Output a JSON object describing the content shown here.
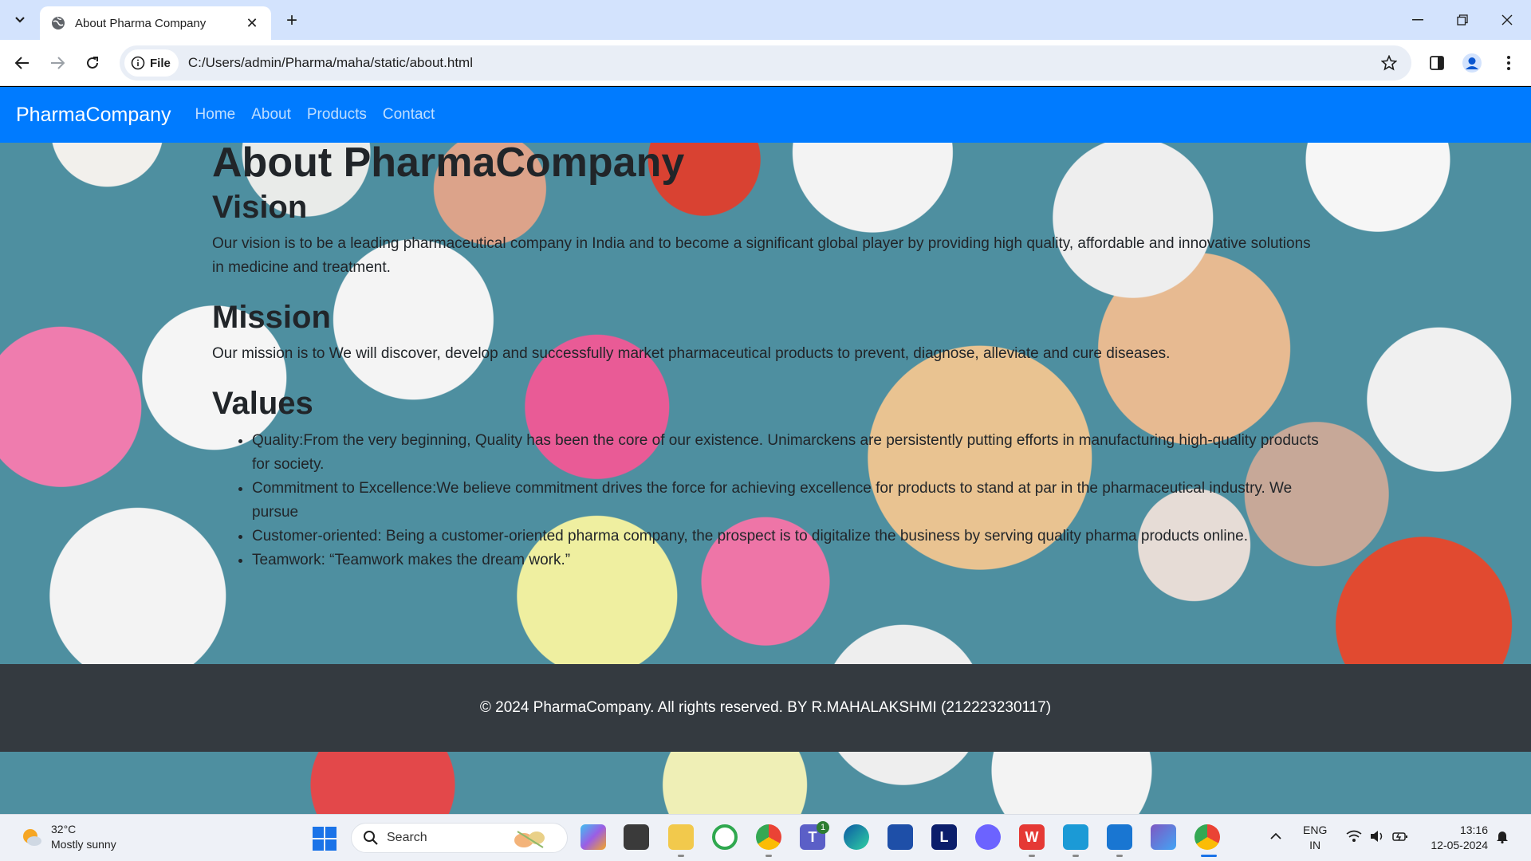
{
  "browser": {
    "tab_title": "About Pharma Company",
    "address_chip": "File",
    "url": "C:/Users/admin/Pharma/maha/static/about.html"
  },
  "site": {
    "brand": "PharmaCompany",
    "nav": [
      "Home",
      "About",
      "Products",
      "Contact"
    ],
    "page_title": "About PharmaCompany",
    "vision_heading": "Vision",
    "vision_text": "Our vision is to be a leading pharmaceutical company in India and to become a significant global player by providing high quality, affordable and innovative solutions in medicine and treatment.",
    "mission_heading": "Mission",
    "mission_text": "Our mission is to We will discover, develop and successfully market pharmaceutical products to prevent, diagnose, alleviate and cure diseases.",
    "values_heading": "Values",
    "values": [
      "Quality:From the very beginning, Quality has been the core of our existence. Unimarckens are persistently putting efforts in manufacturing high-quality products for society.",
      "Commitment to Excellence:We believe commitment drives the force for achieving excellence for products to stand at par in the pharmaceutical industry. We pursue",
      "Customer-oriented: Being a customer-oriented pharma company, the prospect is to digitalize the business by serving quality pharma products online.",
      "Teamwork: “Teamwork makes the dream work.”"
    ],
    "footer": "© 2024 PharmaCompany. All rights reserved. BY R.MAHALAKSHMI (212223230117)"
  },
  "taskbar": {
    "temperature": "32°C",
    "weather": "Mostly sunny",
    "search_placeholder": "Search",
    "teams_badge": "1",
    "language": "ENG",
    "region": "IN",
    "time": "13:16",
    "date": "12-05-2024"
  },
  "colors": {
    "navbar": "#007bff",
    "footer": "#343a40",
    "tabstrip": "#d3e3fd"
  }
}
